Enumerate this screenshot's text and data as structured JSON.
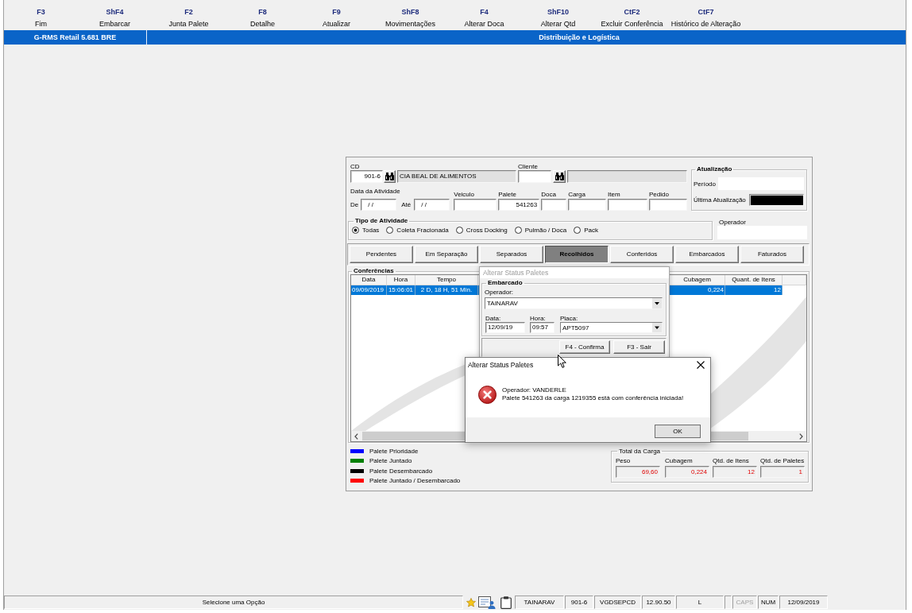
{
  "toolbar": [
    {
      "key": "F3",
      "label": "Fim"
    },
    {
      "key": "ShF4",
      "label": "Embarcar"
    },
    {
      "key": "F2",
      "label": "Junta Palete"
    },
    {
      "key": "F8",
      "label": "Detalhe"
    },
    {
      "key": "F9",
      "label": "Atualizar"
    },
    {
      "key": "ShF8",
      "label": "Movimentações"
    },
    {
      "key": "F4",
      "label": "Alterar Doca"
    },
    {
      "key": "ShF10",
      "label": "Alterar Qtd"
    },
    {
      "key": "CtF2",
      "label": "Excluir Conferência"
    },
    {
      "key": "CtF7",
      "label": "Histórico de Alteração"
    }
  ],
  "header": {
    "app_title": "G-RMS Retail 5.681 BRE",
    "module_title": "Distribuição e Logística"
  },
  "form": {
    "cd": {
      "label": "CD",
      "code": "901-6",
      "name": "CIA BEAL DE ALIMENTOS"
    },
    "cliente": {
      "label": "Cliente"
    },
    "atualizacao": {
      "title": "Atualização",
      "periodo_label": "Período",
      "ultima_label": "Última Atualização"
    },
    "data_atividade": {
      "label": "Data da Atividade",
      "de_label": "De",
      "de_value": "/ /",
      "ate_label": "Até",
      "ate_value": "/ /"
    },
    "filters": [
      {
        "label": "Veiculo"
      },
      {
        "label": "Palete",
        "value": "541263"
      },
      {
        "label": "Doca"
      },
      {
        "label": "Carga"
      },
      {
        "label": "Item"
      },
      {
        "label": "Pedido"
      }
    ],
    "tipo_atividade": {
      "title": "Tipo de Atividade",
      "options": [
        {
          "label": "Todas",
          "selected": true
        },
        {
          "label": "Coleta Fracionada",
          "selected": false
        },
        {
          "label": "Cross Docking",
          "selected": false
        },
        {
          "label": "Pulmão / Doca",
          "selected": false
        },
        {
          "label": "Pack",
          "selected": false
        }
      ]
    },
    "operador": {
      "label": "Operador"
    },
    "tabs": [
      {
        "label": "Pendentes",
        "selected": false
      },
      {
        "label": "Em Separação",
        "selected": false
      },
      {
        "label": "Separados",
        "selected": false
      },
      {
        "label": "Recolhidos",
        "selected": true
      },
      {
        "label": "Conferidos",
        "selected": false
      },
      {
        "label": "Embarcados",
        "selected": false
      },
      {
        "label": "Faturados",
        "selected": false
      }
    ],
    "conferencias": {
      "title": "Conferências",
      "columns": [
        "Data",
        "Hora",
        "Tempo",
        "Cubagem",
        "Quant. de Itens"
      ],
      "rows": [
        {
          "selected": true,
          "cells": [
            "09/09/2019",
            "15:06:01",
            "2 D, 18 H, 51 Min.",
            "0,224",
            "12"
          ]
        }
      ]
    },
    "legend": [
      {
        "label": "Palete Prioridade",
        "color": "#0000ff"
      },
      {
        "label": "Palete Juntado",
        "color": "#008000"
      },
      {
        "label": "Palete Desembarcado",
        "color": "#000000"
      },
      {
        "label": "Palete Juntado / Desembarcado",
        "color": "#ff0000"
      }
    ],
    "total_carga": {
      "title": "Total da Carga",
      "fields": [
        {
          "label": "Peso",
          "value": "69,60"
        },
        {
          "label": "Cubagem",
          "value": "0,224"
        },
        {
          "label": "Qtd. de Itens",
          "value": "12"
        },
        {
          "label": "Qtd. de Paletes",
          "value": "1"
        }
      ]
    }
  },
  "status_dialog": {
    "title": "Alterar Status Paletes",
    "group_title": "Embarcado",
    "operador": {
      "label": "Operador:",
      "value": "TAINARAV"
    },
    "data": {
      "label": "Data:",
      "value": "12/09/19"
    },
    "hora": {
      "label": "Hora:",
      "value": "09:57"
    },
    "placa": {
      "label": "Placa:",
      "value": "APT5097"
    },
    "buttons": [
      "F4 - Confirma",
      "F3 - Sair"
    ]
  },
  "message_box": {
    "title": "Alterar Status Paletes",
    "lines": [
      "Operador: VANDERLE",
      "Palete 541263 da carga 1219355 está com conferência iniciada!"
    ],
    "button": "OK"
  },
  "status_bar": {
    "message": "Selecione uma Opção",
    "fields": [
      "TAINARAV",
      "901-6",
      "VGDSEPCD",
      "12.90.50",
      "L"
    ],
    "indicators": [
      {
        "label": "CAPS",
        "on": false
      },
      {
        "label": "NUM",
        "on": true
      }
    ],
    "date": "12/09/2019"
  }
}
